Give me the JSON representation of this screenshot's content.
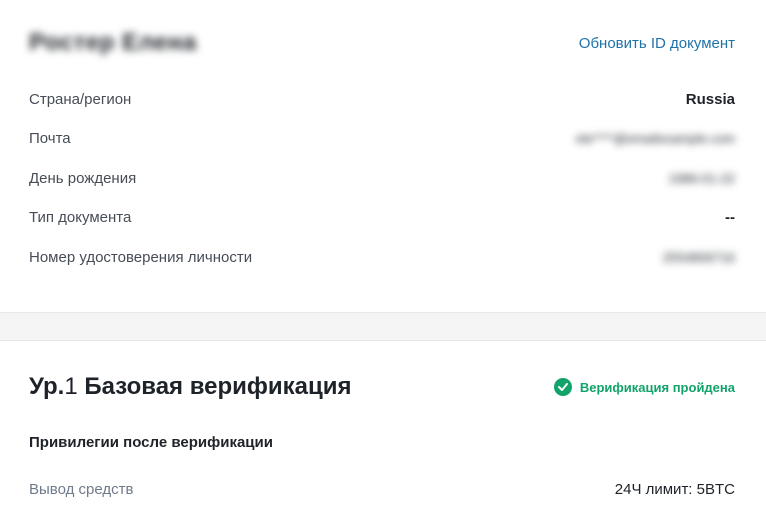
{
  "profile": {
    "name": "Ростер Елена",
    "update_link": "Обновить ID документ"
  },
  "info_rows": [
    {
      "label": "Страна/регион",
      "value": "Russia"
    },
    {
      "label": "Почта",
      "value": "ele****@emailexample.com"
    },
    {
      "label": "День рождения",
      "value": "1986-01-22"
    },
    {
      "label": "Тип документа",
      "value": "--"
    },
    {
      "label": "Номер удостоверения личности",
      "value": "2554806716"
    }
  ],
  "level": {
    "prefix": "Ур.",
    "number": "1",
    "title": " Базовая верификация",
    "status": "Верификация пройдена",
    "status_color": "#12a36b"
  },
  "privileges": {
    "title": "Привилегии после верификации",
    "rows": [
      {
        "label": "Вывод средств",
        "value": "24Ч лимит: 5BTC"
      }
    ]
  },
  "colors": {
    "link": "#1f73a8",
    "success": "#12a36b"
  }
}
